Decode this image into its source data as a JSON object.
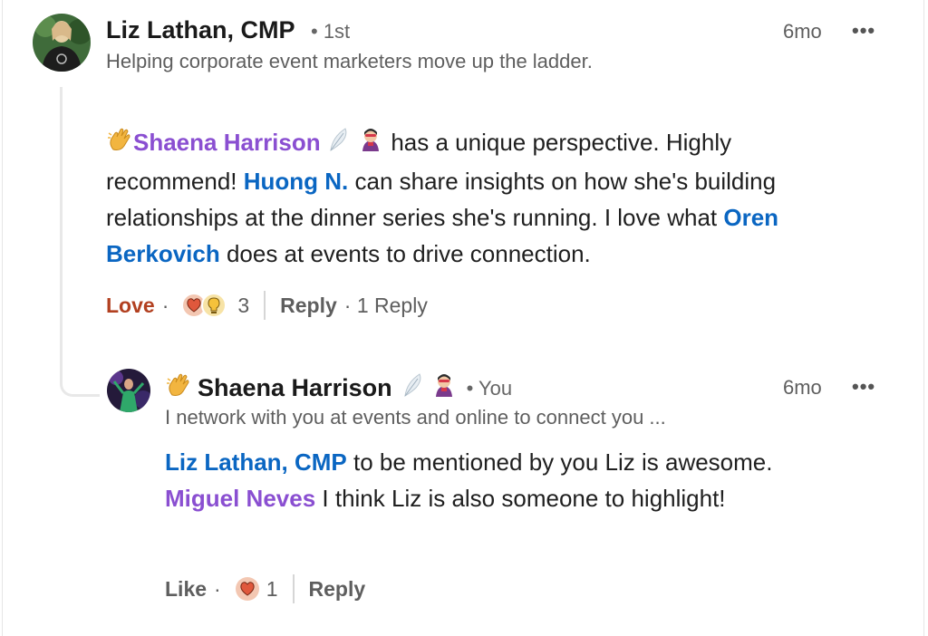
{
  "comment": {
    "author": "Liz Lathan, CMP",
    "degree": "• 1st",
    "headline": "Helping corporate event marketers move up the ladder.",
    "time": "6mo",
    "more": "•••",
    "text": {
      "mention1": "Shaena Harrison",
      "part1": " has a unique perspective. Highly recommend! ",
      "mention2": "Huong N.",
      "part2": " can share insights on how she's building relationships at the dinner series she's running. I love what ",
      "mention3": "Oren Berkovich",
      "part3": " does at events to drive connection."
    },
    "actions": {
      "reaction_label": "Love",
      "dot": "·",
      "reaction_count": "3",
      "reply_label": "Reply",
      "reply_count": "· 1 Reply"
    }
  },
  "reply": {
    "author": "Shaena Harrison",
    "you_label": "• You",
    "headline": "I network with you at events and online to connect you ...",
    "time": "6mo",
    "more": "•••",
    "text": {
      "mention1": "Liz Lathan, CMP",
      "part1": " to be mentioned by you Liz is awesome. ",
      "mention2": "Miguel Neves",
      "part2": " I think Liz is also someone to highlight!"
    },
    "actions": {
      "like_label": "Like",
      "dot": "·",
      "reaction_count": "1",
      "reply_label": "Reply"
    }
  },
  "colors": {
    "mention_blue": "#0a66c2",
    "mention_purple": "#8a4fd1",
    "love": "#b24020"
  },
  "icons": [
    "waving-hand-icon",
    "feather-icon",
    "superhero-icon",
    "love-reaction-icon",
    "insightful-reaction-icon",
    "more-icon"
  ]
}
